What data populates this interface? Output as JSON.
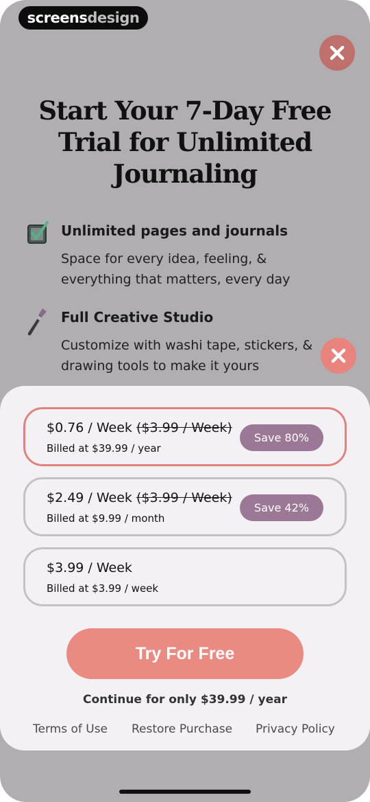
{
  "watermark": {
    "bold": "screens",
    "light": "design"
  },
  "headline": "Start Your 7-Day Free Trial for Unlimited Journaling",
  "features": [
    {
      "icon": "checkbox-icon",
      "title": "Unlimited pages and journals",
      "description": "Space for every idea, feeling, & everything that matters, every day"
    },
    {
      "icon": "paintbrush-icon",
      "title": "Full Creative Studio",
      "description": "Customize with washi tape, stickers, & drawing tools to make it yours"
    }
  ],
  "plans": [
    {
      "price": "$0.76 / Week",
      "original": "($3.99 / Week)",
      "billed": "Billed at $39.99 / year",
      "badge": "Save 80%",
      "selected": true
    },
    {
      "price": "$2.49 / Week",
      "original": "($3.99 / Week)",
      "billed": "Billed at $9.99 / month",
      "badge": "Save 42%",
      "selected": false
    },
    {
      "price": "$3.99 / Week",
      "original": "",
      "billed": "Billed at $3.99 / week",
      "badge": "",
      "selected": false
    }
  ],
  "cta_label": "Try For Free",
  "continue_text": "Continue for only $39.99 / year",
  "links": {
    "terms": "Terms of Use",
    "restore": "Restore Purchase",
    "privacy": "Privacy Policy"
  },
  "colors": {
    "accent": "#e98b82",
    "badge": "#9b7896",
    "overlay": "#b1aeb2",
    "sheet": "#f3f1f5"
  }
}
